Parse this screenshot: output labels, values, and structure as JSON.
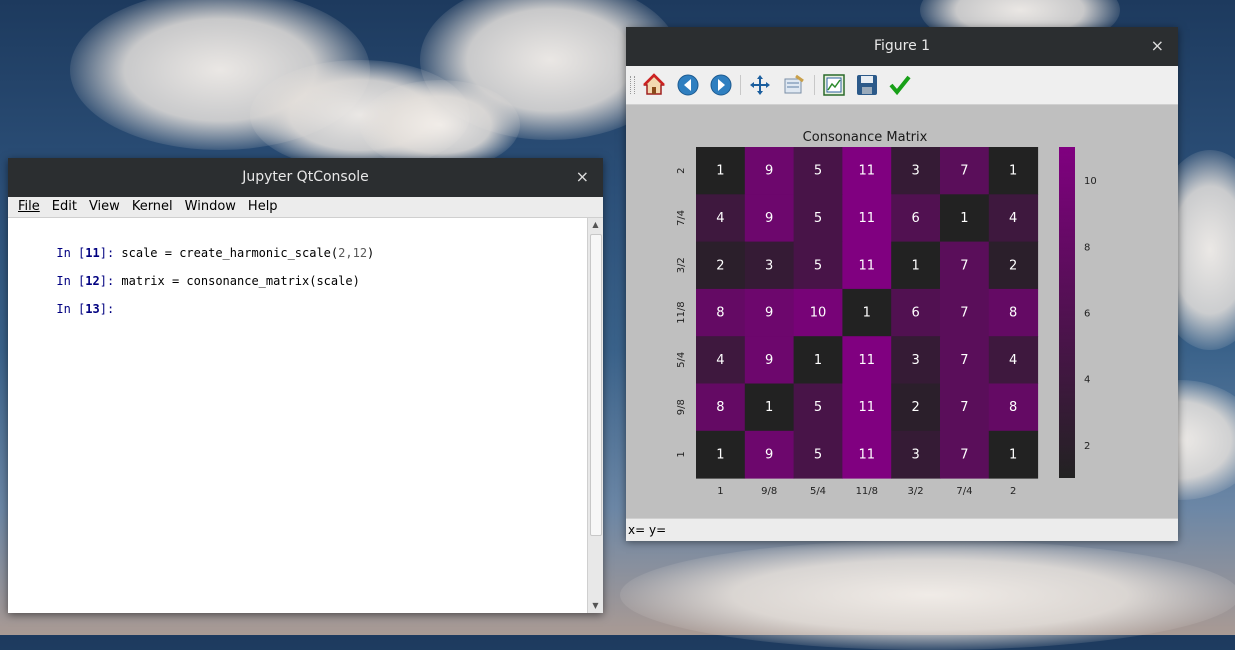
{
  "jupyter": {
    "title": "Jupyter QtConsole",
    "close_glyph": "×",
    "menu": [
      "File",
      "Edit",
      "View",
      "Kernel",
      "Window",
      "Help"
    ],
    "lines": [
      {
        "prompt": "In [",
        "num": "11",
        "end": "]:",
        "code_a": " scale = create_harmonic_scale(",
        "args": "2,12",
        "code_b": ")"
      },
      {
        "prompt": "In [",
        "num": "12",
        "end": "]:",
        "code_a": " matrix = consonance_matrix(scale)",
        "args": "",
        "code_b": ""
      },
      {
        "prompt": "In [",
        "num": "13",
        "end": "]:",
        "code_a": "",
        "args": "",
        "code_b": ""
      }
    ]
  },
  "figure": {
    "title": "Figure 1",
    "close_glyph": "×",
    "status": "x= y=",
    "toolbar": [
      "home-icon",
      "back-icon",
      "forward-icon",
      "pan-icon",
      "configure-icon",
      "subplots-icon",
      "save-icon",
      "apply-icon"
    ]
  },
  "chart_data": {
    "type": "heatmap",
    "title": "Consonance Matrix",
    "x_labels": [
      "1",
      "9/8",
      "5/4",
      "11/8",
      "3/2",
      "7/4",
      "2"
    ],
    "y_labels": [
      "2",
      "7/4",
      "3/2",
      "11/8",
      "5/4",
      "9/8",
      "1"
    ],
    "values": [
      [
        1,
        9,
        5,
        11,
        3,
        7,
        1
      ],
      [
        4,
        9,
        5,
        11,
        6,
        1,
        4
      ],
      [
        2,
        3,
        5,
        11,
        1,
        7,
        2
      ],
      [
        8,
        9,
        10,
        1,
        6,
        7,
        8
      ],
      [
        4,
        9,
        1,
        11,
        3,
        7,
        4
      ],
      [
        8,
        1,
        5,
        11,
        2,
        7,
        8
      ],
      [
        1,
        9,
        5,
        11,
        3,
        7,
        1
      ]
    ],
    "vmin": 1,
    "vmax": 11,
    "colorbar_ticks": [
      2,
      4,
      6,
      8,
      10
    ],
    "color_low": "#222222",
    "color_high": "#800080"
  }
}
